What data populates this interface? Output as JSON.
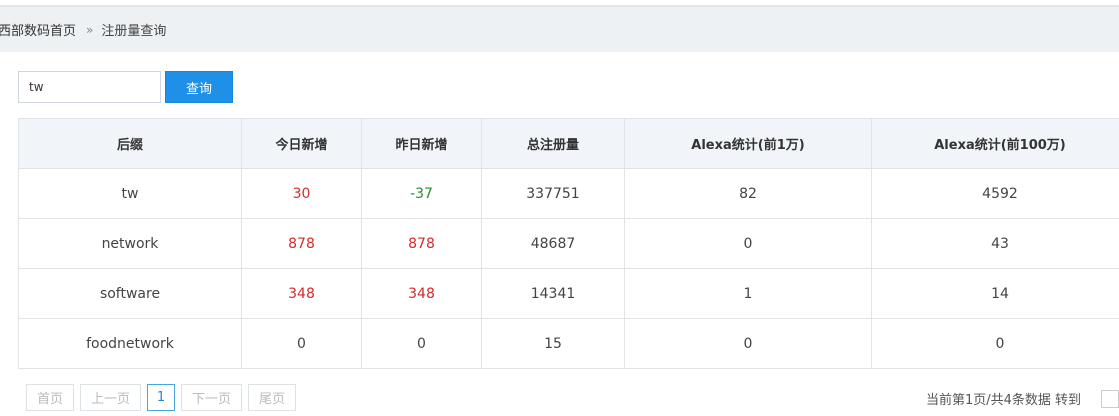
{
  "breadcrumb": {
    "home": "西部数码首页",
    "separator": "»",
    "current": "注册量查询"
  },
  "search": {
    "value": "tw",
    "button_label": "查询"
  },
  "table": {
    "headers": [
      "后缀",
      "今日新增",
      "昨日新增",
      "总注册量",
      "Alexa统计(前1万)",
      "Alexa统计(前100万)"
    ],
    "rows": [
      {
        "suffix": "tw",
        "today": "30",
        "yesterday": "-37",
        "total": "337751",
        "alexa_10k": "82",
        "alexa_1m": "4592"
      },
      {
        "suffix": "network",
        "today": "878",
        "yesterday": "878",
        "total": "48687",
        "alexa_10k": "0",
        "alexa_1m": "43"
      },
      {
        "suffix": "software",
        "today": "348",
        "yesterday": "348",
        "total": "14341",
        "alexa_10k": "1",
        "alexa_1m": "14"
      },
      {
        "suffix": "foodnetwork",
        "today": "0",
        "yesterday": "0",
        "total": "15",
        "alexa_10k": "0",
        "alexa_1m": "0"
      }
    ]
  },
  "pagination": {
    "first": "首页",
    "prev": "上一页",
    "current_page": "1",
    "next": "下一页",
    "last": "尾页",
    "info": "当前第1页/共4条数据 转到"
  },
  "colors": {
    "positive": "#d42b2b",
    "negative": "#2a8a2a",
    "accent": "#1e90e8"
  }
}
